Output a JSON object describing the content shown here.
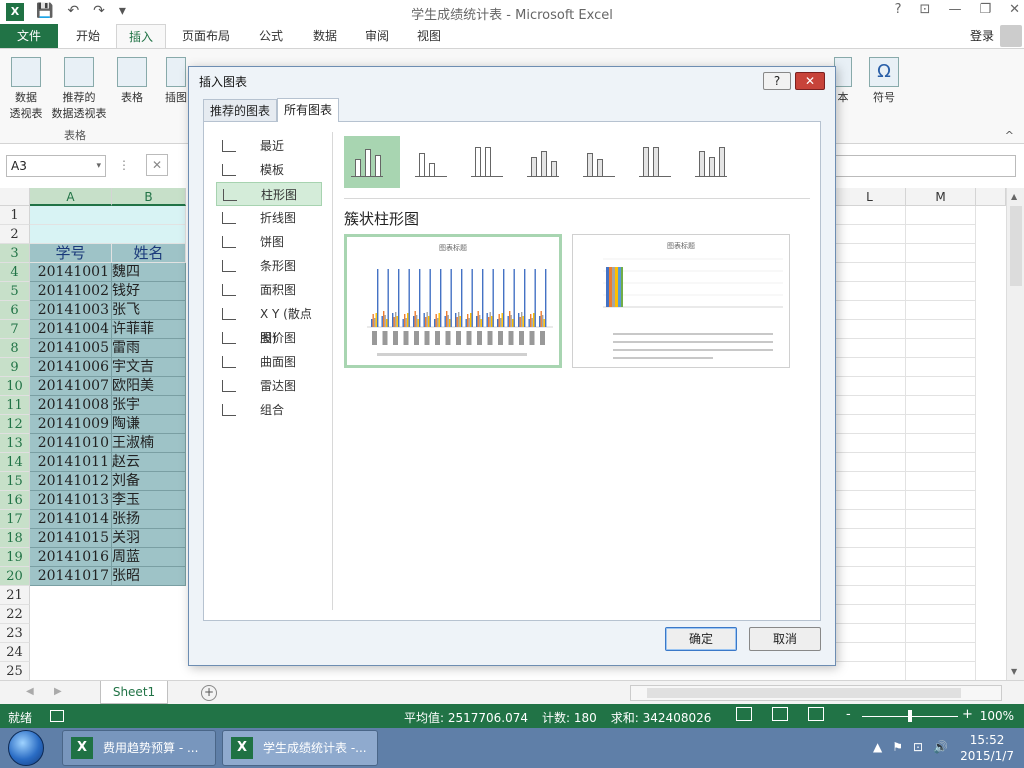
{
  "window": {
    "title": "学生成绩统计表 - Microsoft Excel",
    "app_icon": "X",
    "controls": [
      "?",
      "⊡",
      "—",
      "❐",
      "✕"
    ]
  },
  "qat": {
    "save": "💾",
    "undo": "↶",
    "redo": "↷",
    "customize": "▾"
  },
  "tabs": [
    "文件",
    "开始",
    "插入",
    "页面布局",
    "公式",
    "数据",
    "审阅",
    "视图"
  ],
  "active_tab": "插入",
  "login": "登录",
  "ribbon": {
    "buttons": [
      {
        "label": "数据\n透视表"
      },
      {
        "label": "推荐的\n数据透视表"
      },
      {
        "label": "表格"
      },
      {
        "label": "插图"
      }
    ],
    "right_buttons": [
      {
        "label": "本"
      },
      {
        "label": "符号",
        "glyph": "Ω"
      }
    ],
    "group_label": "表格",
    "collapse": "^"
  },
  "formula_bar": {
    "name_box": "A3",
    "name_box_dd": "▾",
    "sep": "⋮",
    "cancel": "✕"
  },
  "columns": [
    {
      "label": "A",
      "selected": true
    },
    {
      "label": "B",
      "selected": true
    },
    {
      "label": "L",
      "selected": false
    },
    {
      "label": "M",
      "selected": false
    }
  ],
  "rows": [
    "1",
    "2",
    "3",
    "4",
    "5",
    "6",
    "7",
    "8",
    "9",
    "10",
    "11",
    "12",
    "13",
    "14",
    "15",
    "16",
    "17",
    "18",
    "19",
    "20",
    "21",
    "22",
    "23",
    "24",
    "25"
  ],
  "header_row": {
    "id": "学号",
    "name": "姓名"
  },
  "students": [
    {
      "id": "20141001",
      "name": "魏四"
    },
    {
      "id": "20141002",
      "name": "钱好"
    },
    {
      "id": "20141003",
      "name": "张飞"
    },
    {
      "id": "20141004",
      "name": "许菲菲"
    },
    {
      "id": "20141005",
      "name": "雷雨"
    },
    {
      "id": "20141006",
      "name": "宇文吉"
    },
    {
      "id": "20141007",
      "name": "欧阳美"
    },
    {
      "id": "20141008",
      "name": "张宇"
    },
    {
      "id": "20141009",
      "name": "陶谦"
    },
    {
      "id": "20141010",
      "name": "王淑楠"
    },
    {
      "id": "20141011",
      "name": "赵云"
    },
    {
      "id": "20141012",
      "name": "刘备"
    },
    {
      "id": "20141013",
      "name": "李玉"
    },
    {
      "id": "20141014",
      "name": "张扬"
    },
    {
      "id": "20141015",
      "name": "关羽"
    },
    {
      "id": "20141016",
      "name": "周蓝"
    },
    {
      "id": "20141017",
      "name": "张昭"
    }
  ],
  "sheet": {
    "tab": "Sheet1",
    "add": "+",
    "nav_prev": "◀",
    "nav_next": "▶"
  },
  "status": {
    "ready": "就绪",
    "average": "平均值: 2517706.074",
    "count": "计数: 180",
    "sum": "求和: 342408026",
    "zoom_minus": "-",
    "zoom_plus": "+",
    "zoom": "100%",
    "zoom_fraction": 0.5
  },
  "taskbar": {
    "tasks": [
      {
        "label": "费用趋势预算 - ...",
        "active": false
      },
      {
        "label": "学生成绩统计表 -...",
        "active": true
      }
    ],
    "tray": [
      "▲",
      "⚑",
      "⊡",
      "🔊"
    ],
    "time": "15:52",
    "date": "2015/1/7"
  },
  "dialog": {
    "title": "插入图表",
    "help": "?",
    "close": "✕",
    "tabs": [
      {
        "label": "推荐的图表",
        "active": false
      },
      {
        "label": "所有图表",
        "active": true
      }
    ],
    "categories": [
      {
        "label": "最近",
        "icon": "recent-icon"
      },
      {
        "label": "模板",
        "icon": "folder-icon"
      },
      {
        "label": "柱形图",
        "icon": "column-chart-icon",
        "selected": true
      },
      {
        "label": "折线图",
        "icon": "line-chart-icon"
      },
      {
        "label": "饼图",
        "icon": "pie-chart-icon"
      },
      {
        "label": "条形图",
        "icon": "bar-chart-icon"
      },
      {
        "label": "面积图",
        "icon": "area-chart-icon"
      },
      {
        "label": "X Y (散点图)",
        "icon": "scatter-chart-icon"
      },
      {
        "label": "股价图",
        "icon": "stock-chart-icon"
      },
      {
        "label": "曲面图",
        "icon": "surface-chart-icon"
      },
      {
        "label": "雷达图",
        "icon": "radar-chart-icon"
      },
      {
        "label": "组合",
        "icon": "combo-chart-icon"
      }
    ],
    "subtype_count": 7,
    "selected_subtype": 0,
    "subtype_name": "簇状柱形图",
    "previews": [
      {
        "title": "图表标题",
        "selected": true
      },
      {
        "title": "图表标题",
        "selected": false
      }
    ],
    "ok": "确定",
    "cancel": "取消"
  }
}
